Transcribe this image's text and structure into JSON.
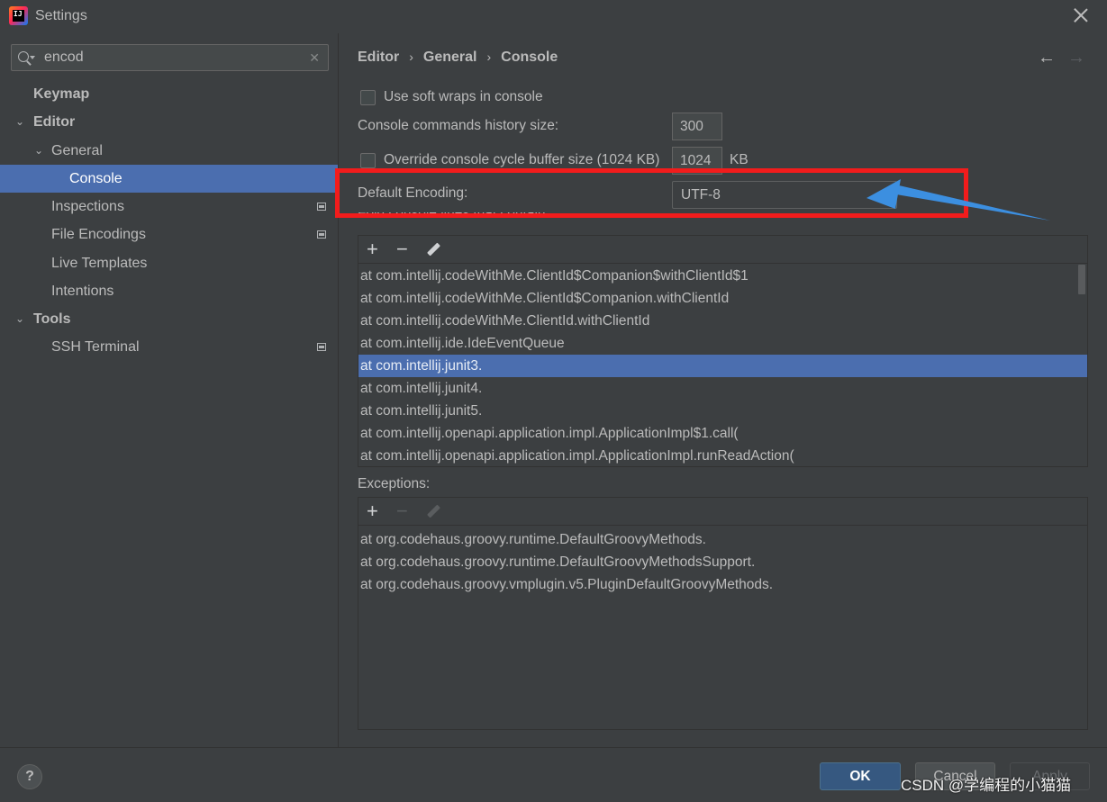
{
  "window": {
    "title": "Settings"
  },
  "sidebar": {
    "search": {
      "value": "encod"
    },
    "tree": [
      {
        "label": "Keymap"
      },
      {
        "label": "Editor"
      },
      {
        "label": "General"
      },
      {
        "label": "Console"
      },
      {
        "label": "Inspections"
      },
      {
        "label": "File Encodings"
      },
      {
        "label": "Live Templates"
      },
      {
        "label": "Intentions"
      },
      {
        "label": "Tools"
      },
      {
        "label": "SSH Terminal"
      }
    ]
  },
  "breadcrumb": [
    "Editor",
    "General",
    "Console"
  ],
  "options": {
    "soft_wraps_label": "Use soft wraps in console",
    "history_label": "Console commands history size:",
    "history_value": "300",
    "override_label": "Override console cycle buffer size (1024 KB)",
    "buffer_value": "1024",
    "buffer_unit": "KB",
    "encoding_label": "Default Encoding:",
    "encoding_value": "UTF-8",
    "fold_label": "Fold console lines that contain:"
  },
  "fold_lines": [
    "at com.intellij.codeWithMe.ClientId$Companion$withClientId$1",
    "at com.intellij.codeWithMe.ClientId$Companion.withClientId",
    "at com.intellij.codeWithMe.ClientId.withClientId",
    "at com.intellij.ide.IdeEventQueue",
    "at com.intellij.junit3.",
    "at com.intellij.junit4.",
    "at com.intellij.junit5.",
    "at com.intellij.openapi.application.impl.ApplicationImpl$1.call(",
    "at com.intellij.openapi.application.impl.ApplicationImpl.runReadAction("
  ],
  "exceptions": {
    "label": "Exceptions:",
    "lines": [
      "at org.codehaus.groovy.runtime.DefaultGroovyMethods.",
      "at org.codehaus.groovy.runtime.DefaultGroovyMethodsSupport.",
      "at org.codehaus.groovy.vmplugin.v5.PluginDefaultGroovyMethods."
    ]
  },
  "toolbar": {
    "add": "+",
    "remove": "−"
  },
  "footer": {
    "help": "?",
    "ok": "OK",
    "cancel": "Cancel",
    "apply": "Apply"
  },
  "icons": {
    "app": "intellij-icon",
    "close": "close-icon",
    "search": "search-icon",
    "back": "←",
    "forward": "→",
    "expanded": "⌄"
  },
  "watermark": "CSDN @学编程的小猫猫",
  "colors": {
    "selection": "#4b6eaf",
    "annotation": "#f21c1c",
    "arrow": "#3c8fe0"
  }
}
